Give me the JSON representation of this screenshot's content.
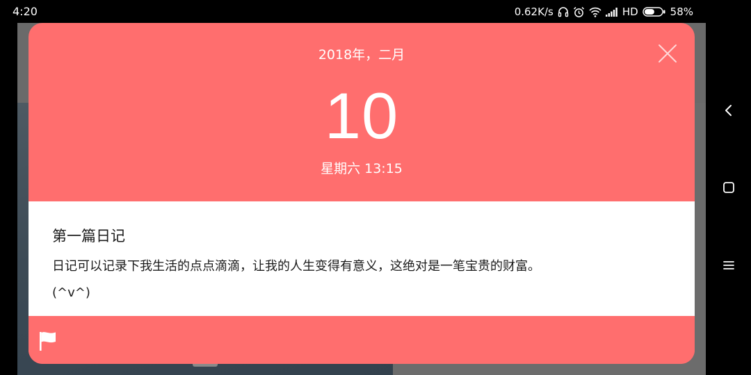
{
  "status_bar": {
    "time": "4:20",
    "network_speed": "0.62K/s",
    "network_type": "HD",
    "battery": "58%",
    "battery_level": 0.58,
    "icons": [
      "headphones-icon",
      "alarm-icon",
      "wifi-icon",
      "signal-icon",
      "battery-icon"
    ]
  },
  "dialog": {
    "month_year": "2018年，二月",
    "day": "10",
    "weekday_time": "星期六 13:15",
    "close_icon": "close-icon",
    "entry": {
      "title": "第一篇日记",
      "text": "日记可以记录下我生活的点点滴滴，让我的人生变得有意义，这绝对是一笔宝贵的财富。",
      "emoticon": "(^v^)"
    },
    "footer_icon": "flag-icon"
  },
  "nav_bar": {
    "icons": [
      "back-icon",
      "home-icon",
      "menu-icon"
    ]
  },
  "colors": {
    "accent": "#ff6e6e",
    "card_background": "#ffffff",
    "text": "#1a1a1a",
    "system_bar": "#000000"
  }
}
